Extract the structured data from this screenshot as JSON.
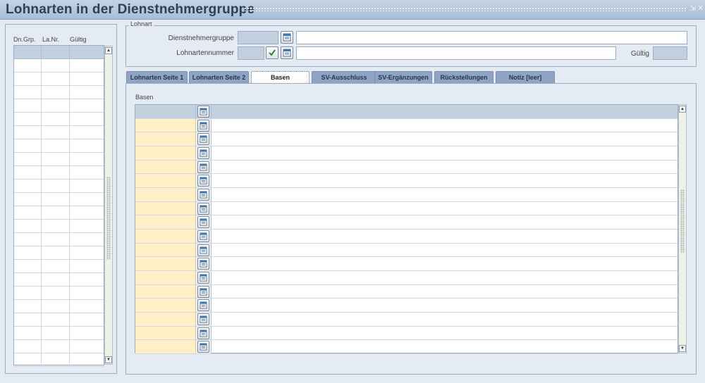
{
  "window": {
    "title": "Lohnarten in der Dienstnehmergruppe",
    "minimize_glyph": "⇲",
    "close_glyph": "✕"
  },
  "left_table": {
    "columns": [
      "Dn.Grp.",
      "La.Nr.",
      "Gültig"
    ],
    "row_count": 23
  },
  "lohnart": {
    "legend": "Lohnart",
    "dienstnehmergruppe_label": "Dienstnehmergruppe",
    "lohnartennummer_label": "Lohnartennummer",
    "gueltig_label": "Gültig",
    "dienstnehmergruppe_value": "",
    "dienstnehmergruppe_name": "",
    "lohnartennummer_value": "",
    "lohnartennummer_name": "",
    "gueltig_value": ""
  },
  "tabs": [
    {
      "label": "Lohnarten Seite 1",
      "active": false
    },
    {
      "label": "Lohnarten Seite 2",
      "active": false
    },
    {
      "label": "Basen",
      "active": true
    },
    {
      "label": "SV-Ausschluss",
      "active": false
    },
    {
      "label": "SV-Ergänzungen",
      "active": false
    },
    {
      "label": "Rückstellungen",
      "active": false
    },
    {
      "label": "Notiz [leer]",
      "active": false
    }
  ],
  "basen": {
    "label": "Basen",
    "row_count": 17
  },
  "icons": {
    "lookup": "list-lookup-icon",
    "confirm": "checkmark-icon"
  },
  "colors": {
    "title": "#2e3f57",
    "tab": "#8ea4c2",
    "key_cell": "#feefc7",
    "field_grey": "#c3d0e0"
  }
}
